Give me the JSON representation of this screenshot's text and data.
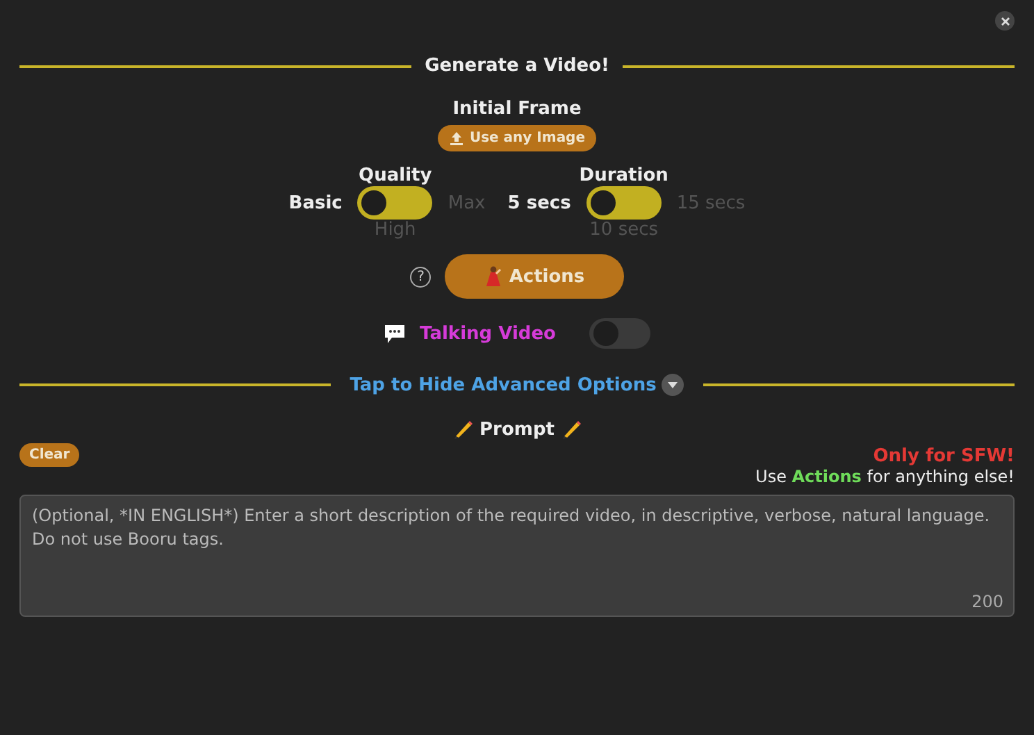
{
  "title": "Generate a Video!",
  "initial_frame": {
    "label": "Initial Frame",
    "button": "Use any Image"
  },
  "selectors": [
    {
      "label": "Quality",
      "options": [
        {
          "label": "Basic",
          "selected": true
        },
        {
          "label": "High",
          "selected": false
        },
        {
          "label": "Max",
          "selected": false
        }
      ]
    },
    {
      "label": "Duration",
      "options": [
        {
          "label": "5 secs",
          "selected": true
        },
        {
          "label": "10 secs",
          "selected": false
        },
        {
          "label": "15 secs",
          "selected": false
        }
      ]
    }
  ],
  "help": "?",
  "actions_button": "Actions",
  "talking_video": {
    "label": "Talking Video",
    "on": false
  },
  "advanced_toggle": "Tap to Hide Advanced Options",
  "prompt": {
    "label": "Prompt",
    "clear": "Clear",
    "warning": "Only for SFW!",
    "note": "Use **Actions** for anything else!",
    "placeholder": "(Optional, *IN ENGLISH*) Enter a short description of the required video, in descriptive, verbose, natural language. Do not use Booru tags.",
    "counter": "200"
  }
}
